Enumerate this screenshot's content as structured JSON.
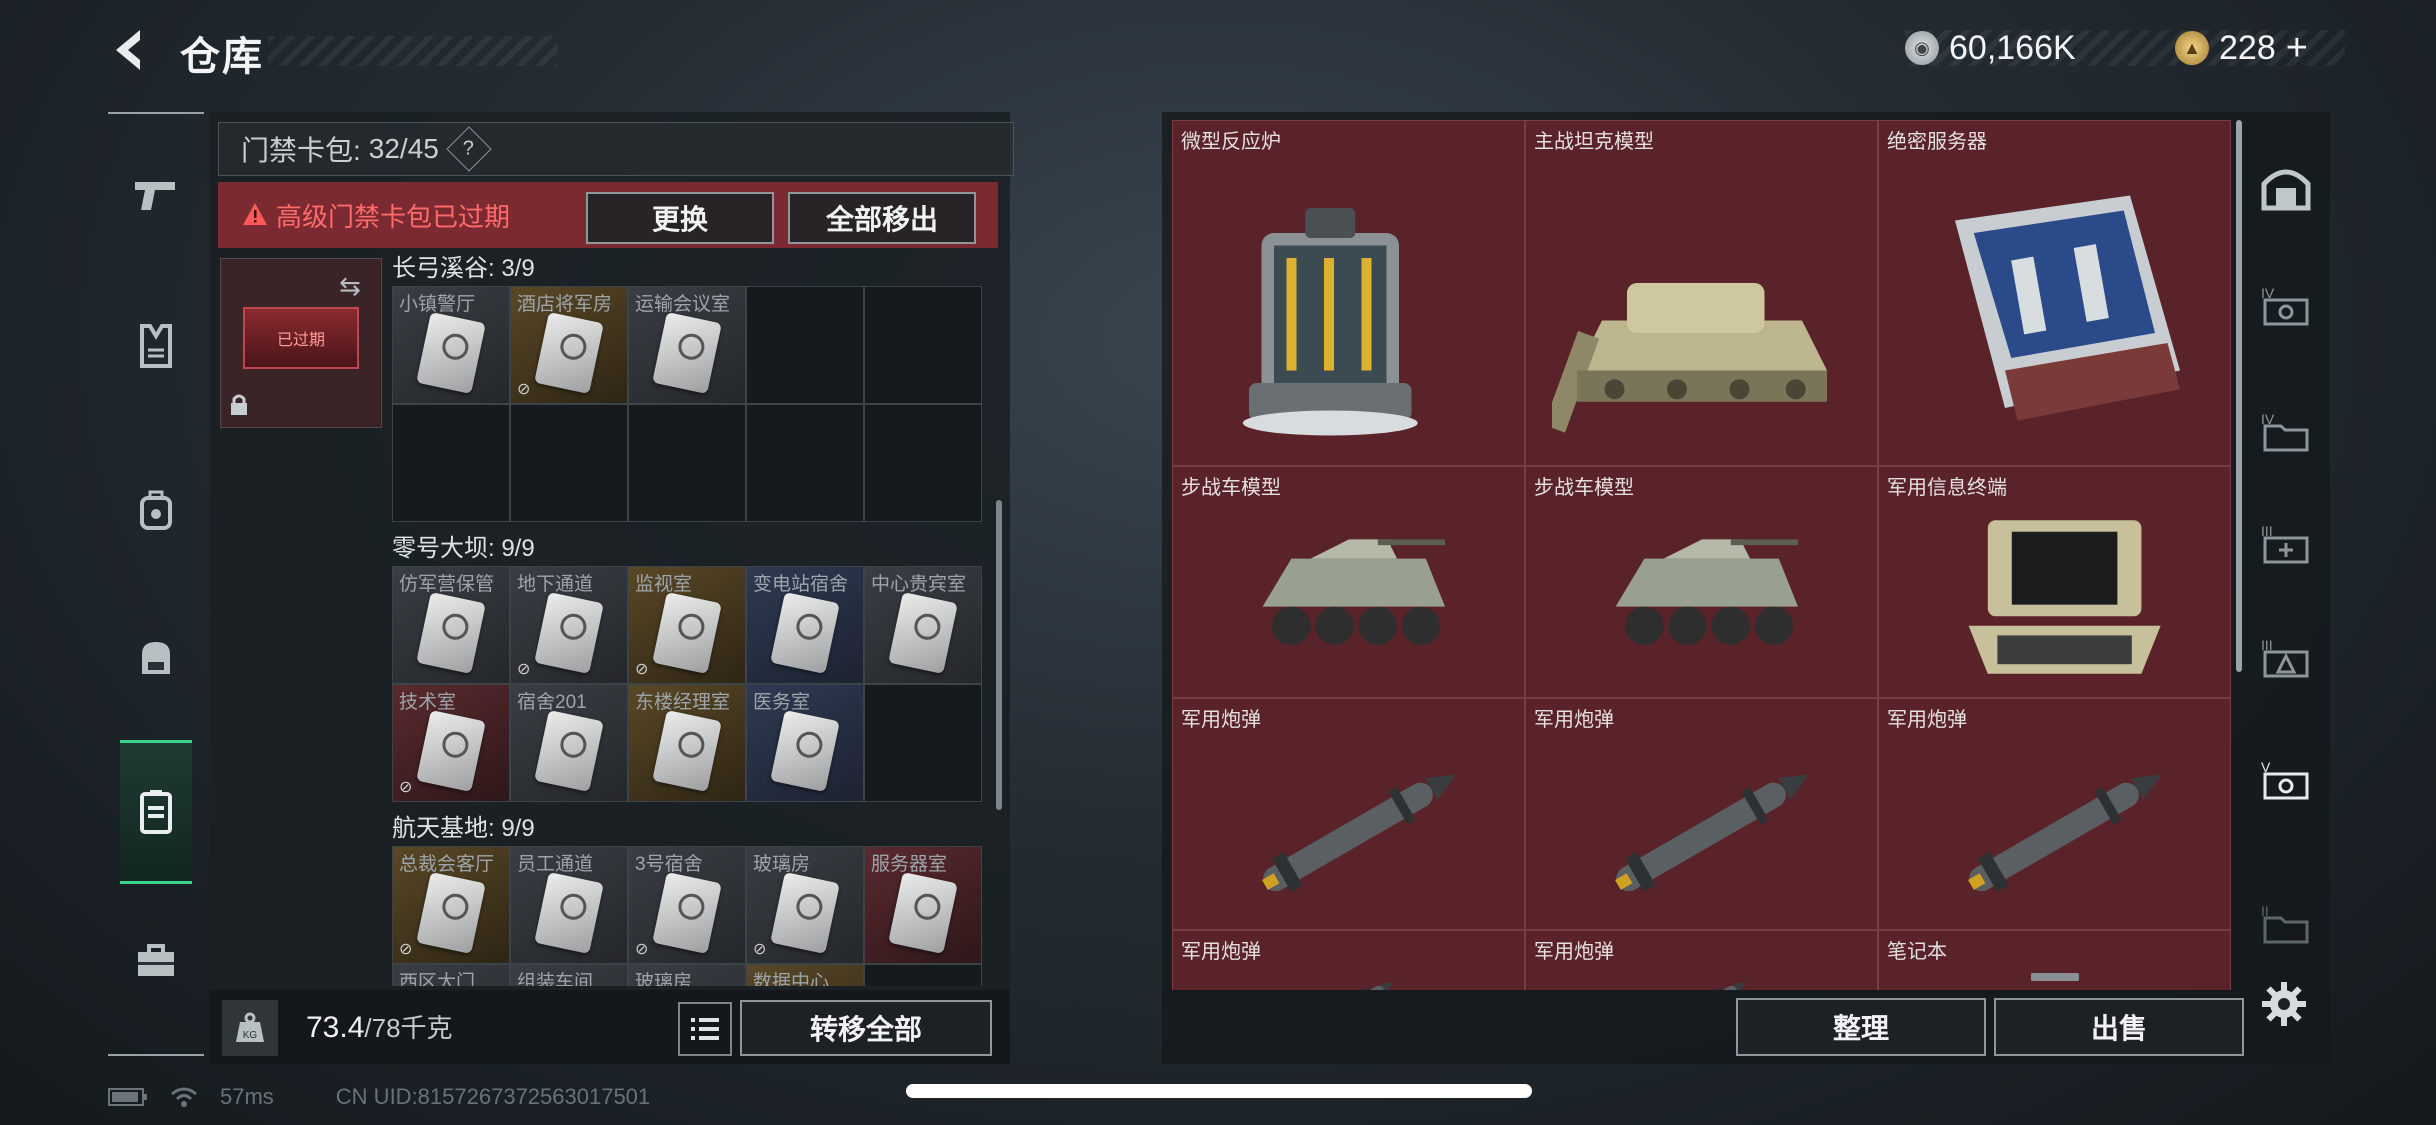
{
  "header": {
    "title": "仓库",
    "currency1": "60,166K",
    "currency2": "228",
    "currency2_plus": "+"
  },
  "left_nav": [
    "pistol-icon",
    "armor-icon",
    "backpack-icon",
    "bag-icon",
    "keycard-case-icon",
    "toolbox-icon"
  ],
  "keypack": {
    "label": "门禁卡包:",
    "count": "32/45",
    "help": "?",
    "warning": "高级门禁卡包已过期",
    "replace_label": "更换",
    "remove_all_label": "全部移出",
    "card_mini_label": "已过期"
  },
  "sections": [
    {
      "title": "长弓溪谷: 3/9",
      "slots": [
        {
          "label": "小镇警厅",
          "tint": "gray",
          "nox": false,
          "card": true
        },
        {
          "label": "酒店将军房",
          "tint": "gold",
          "nox": true,
          "card": true
        },
        {
          "label": "运输会议室",
          "tint": "gray",
          "nox": false,
          "card": true
        },
        {
          "label": "",
          "tint": "empty",
          "nox": false,
          "card": false
        },
        {
          "label": "",
          "tint": "empty",
          "nox": false,
          "card": false
        },
        {
          "label": "",
          "tint": "empty",
          "nox": false,
          "card": false
        },
        {
          "label": "",
          "tint": "empty",
          "nox": false,
          "card": false
        },
        {
          "label": "",
          "tint": "empty",
          "nox": false,
          "card": false
        },
        {
          "label": "",
          "tint": "empty",
          "nox": false,
          "card": false
        },
        {
          "label": "",
          "tint": "empty",
          "nox": false,
          "card": false
        }
      ]
    },
    {
      "title": "零号大坝: 9/9",
      "slots": [
        {
          "label": "仿军营保管",
          "tint": "gray",
          "nox": false,
          "card": true
        },
        {
          "label": "地下通道",
          "tint": "gray",
          "nox": true,
          "card": true
        },
        {
          "label": "监视室",
          "tint": "gold",
          "nox": true,
          "card": true
        },
        {
          "label": "变电站宿舍",
          "tint": "blue",
          "nox": false,
          "card": true
        },
        {
          "label": "中心贵宾室",
          "tint": "gray",
          "nox": false,
          "card": true
        },
        {
          "label": "技术室",
          "tint": "red",
          "nox": true,
          "card": true
        },
        {
          "label": "宿舍201",
          "tint": "gray",
          "nox": false,
          "card": true
        },
        {
          "label": "东楼经理室",
          "tint": "gold",
          "nox": false,
          "card": true
        },
        {
          "label": "医务室",
          "tint": "blue",
          "nox": false,
          "card": true
        },
        {
          "label": "",
          "tint": "empty",
          "nox": false,
          "card": false
        }
      ]
    },
    {
      "title": "航天基地: 9/9",
      "slots": [
        {
          "label": "总裁会客厅",
          "tint": "gold",
          "nox": true,
          "card": true
        },
        {
          "label": "员工通道",
          "tint": "gray",
          "nox": false,
          "card": true
        },
        {
          "label": "3号宿舍",
          "tint": "gray",
          "nox": true,
          "card": true
        },
        {
          "label": "玻璃房",
          "tint": "gray",
          "nox": true,
          "card": true
        },
        {
          "label": "服务器室",
          "tint": "red",
          "nox": false,
          "card": true
        },
        {
          "label": "西区大门",
          "tint": "gray",
          "nox": false,
          "card": false
        },
        {
          "label": "组装车间",
          "tint": "gray",
          "nox": false,
          "card": false
        },
        {
          "label": "玻璃房",
          "tint": "gray",
          "nox": false,
          "card": false
        },
        {
          "label": "数据中心",
          "tint": "gold",
          "nox": false,
          "card": false
        },
        {
          "label": "",
          "tint": "empty",
          "nox": false,
          "card": false
        }
      ]
    }
  ],
  "capacity": {
    "kg_label": "KG",
    "current": "73.4",
    "max": "/78千克",
    "transfer_all_label": "转移全部"
  },
  "items": [
    {
      "name": "微型反应炉",
      "shape": "reactor"
    },
    {
      "name": "主战坦克模型",
      "shape": "tank"
    },
    {
      "name": "绝密服务器",
      "shape": "server"
    },
    {
      "name": "步战车模型",
      "shape": "ifv"
    },
    {
      "name": "步战车模型",
      "shape": "ifv"
    },
    {
      "name": "军用信息终端",
      "shape": "terminal"
    },
    {
      "name": "军用炮弹",
      "shape": "missile"
    },
    {
      "name": "军用炮弹",
      "shape": "missile"
    },
    {
      "name": "军用炮弹",
      "shape": "missile"
    },
    {
      "name": "军用炮弹",
      "shape": "missile"
    },
    {
      "name": "军用炮弹",
      "shape": "missile"
    },
    {
      "name": "笔记本",
      "shape": "laptop"
    }
  ],
  "actions": {
    "sort_label": "整理",
    "sell_label": "出售"
  },
  "right_nav": [
    "vault-icon",
    "storage-iv-a-icon",
    "storage-iv-b-icon",
    "storage-iii-a-icon",
    "storage-iii-b-icon",
    "storage-v-icon",
    "storage-ii-icon"
  ],
  "status": {
    "ping": "57ms",
    "uid": "CN UID:8157267372563017501"
  },
  "colors": {
    "accent_green": "#39d58a",
    "warning_red": "#ff6a6a",
    "item_bg": "#5a2329"
  }
}
